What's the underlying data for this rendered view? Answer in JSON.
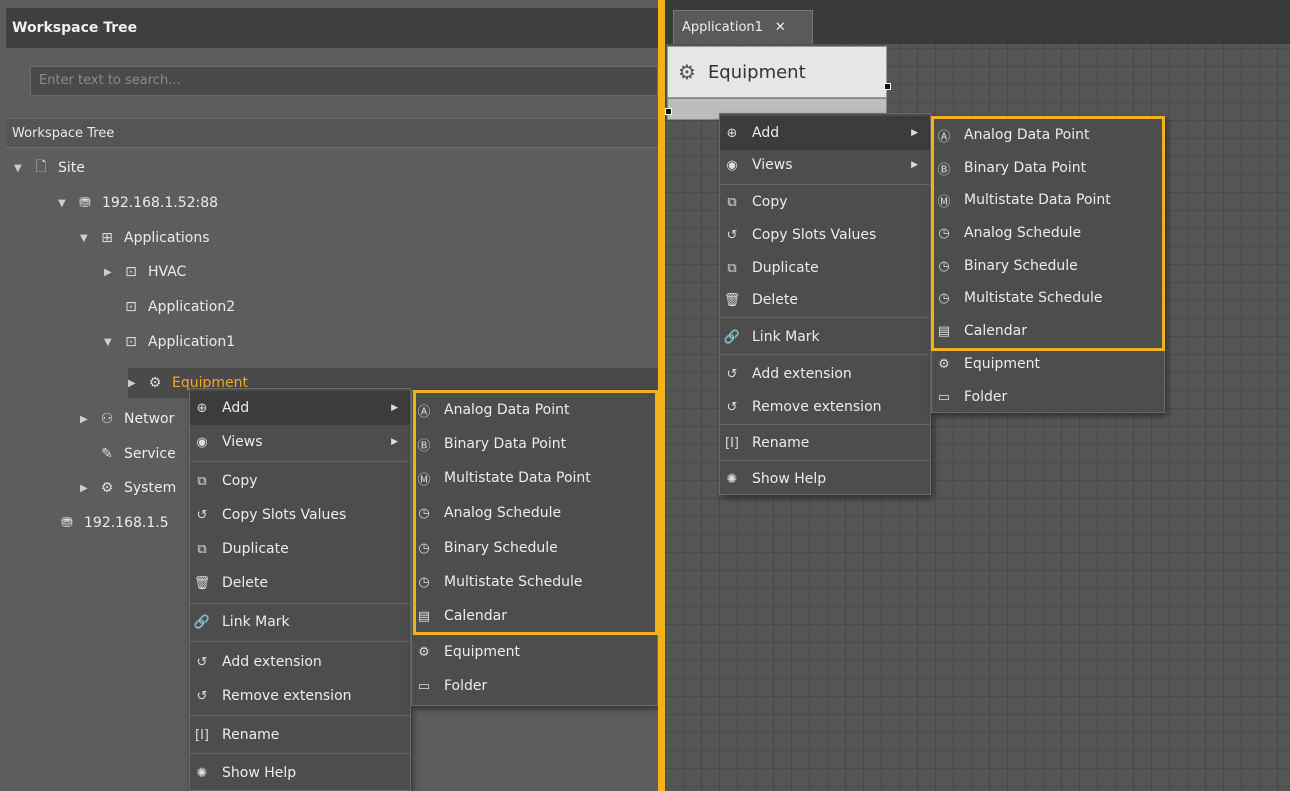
{
  "left": {
    "title": "Workspace Tree",
    "search_placeholder": "Enter text to search...",
    "subheader": "Workspace Tree",
    "tree": [
      {
        "label": "Site",
        "icon": "page-icon"
      },
      {
        "label": "192.168.1.52:88",
        "icon": "server-icon"
      },
      {
        "label": "Applications",
        "icon": "applications-icon"
      },
      {
        "label": "HVAC",
        "icon": "application-icon"
      },
      {
        "label": "Application2",
        "icon": "application-icon"
      },
      {
        "label": "Application1",
        "icon": "application-icon"
      },
      {
        "label": "Equipment",
        "icon": "equipment-icon"
      },
      {
        "label": "Networ",
        "icon": "network-icon"
      },
      {
        "label": "Service",
        "icon": "services-icon"
      },
      {
        "label": "System",
        "icon": "system-icon"
      },
      {
        "label": "192.168.1.5",
        "icon": "server-offline-icon"
      }
    ]
  },
  "context_menu": {
    "items": [
      "Add",
      "Views",
      "Copy",
      "Copy Slots Values",
      "Duplicate",
      "Delete",
      "Link Mark",
      "Add extension",
      "Remove extension",
      "Rename",
      "Show Help"
    ]
  },
  "add_submenu": {
    "items": [
      "Analog Data Point",
      "Binary Data Point",
      "Multistate Data Point",
      "Analog Schedule",
      "Binary Schedule",
      "Multistate Schedule",
      "Calendar",
      "Equipment",
      "Folder"
    ]
  },
  "right": {
    "tab_label": "Application1",
    "tab_close": "✕",
    "equipment_label": "Equipment"
  },
  "colors": {
    "accent": "#f2b21a",
    "selected_text": "#f5a623",
    "panel": "#5d5d5d",
    "menu": "#4d4d4d"
  }
}
